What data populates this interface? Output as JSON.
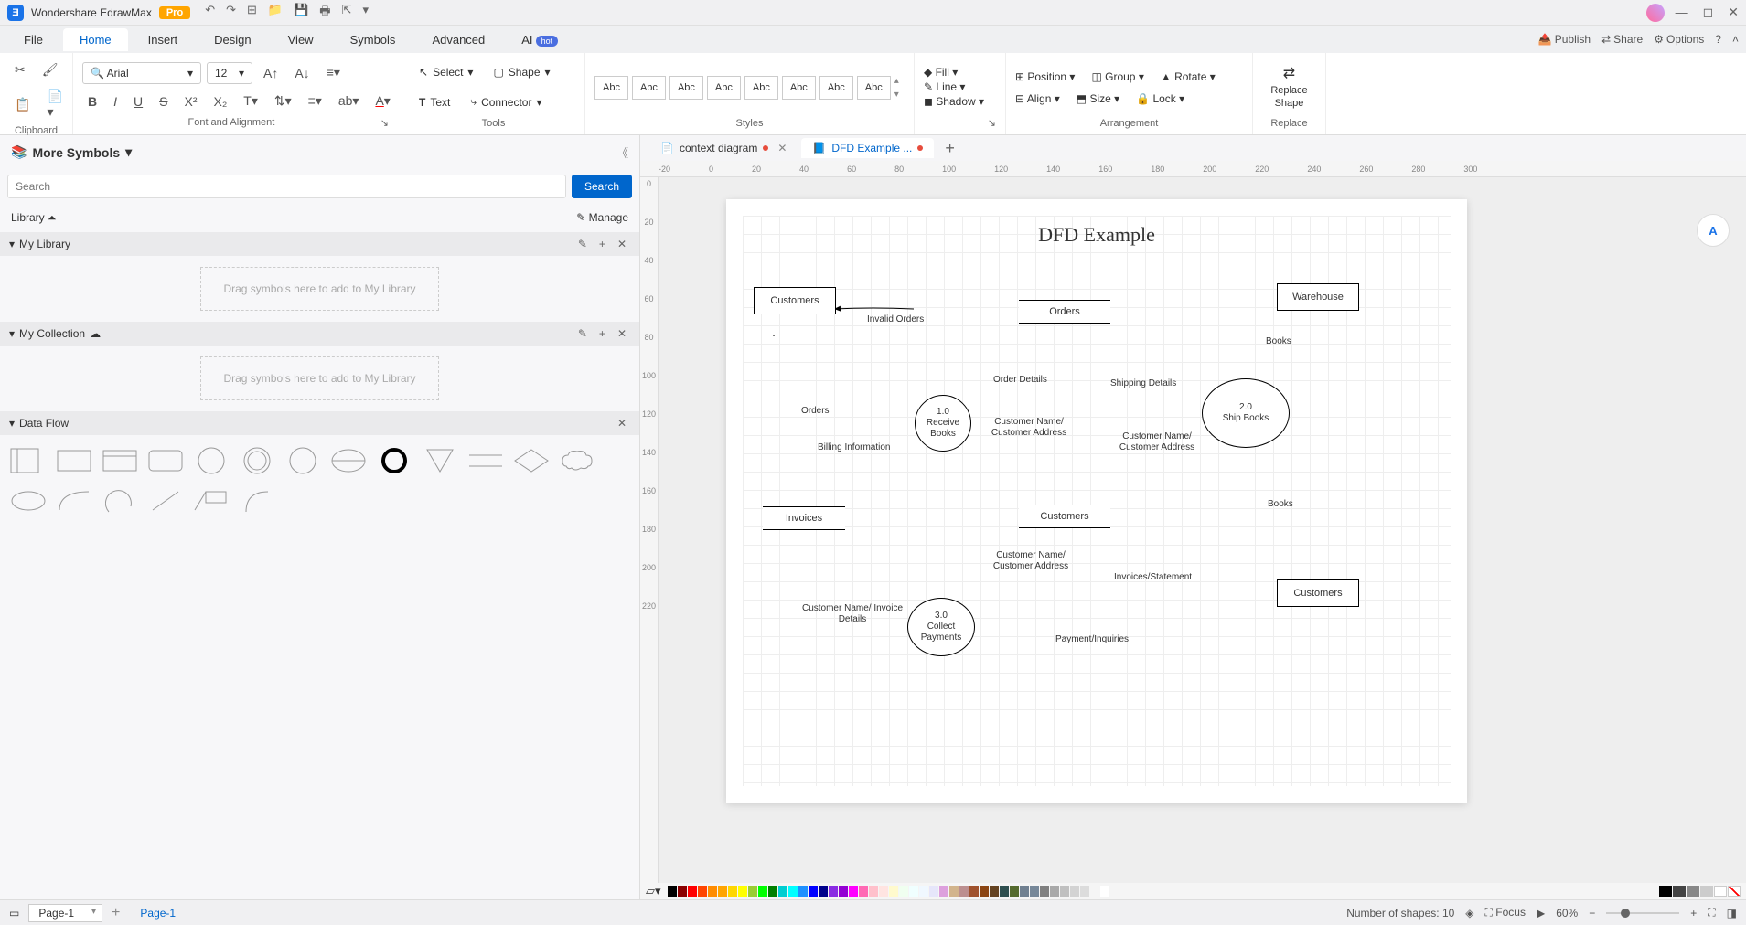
{
  "app": {
    "title": "Wondershare EdrawMax",
    "badge": "Pro"
  },
  "menu": {
    "items": [
      "File",
      "Home",
      "Insert",
      "Design",
      "View",
      "Symbols",
      "Advanced",
      "AI"
    ],
    "active": "Home",
    "hot": "hot",
    "right": {
      "publish": "Publish",
      "share": "Share",
      "options": "Options"
    }
  },
  "ribbon": {
    "font": "Arial",
    "size": "12",
    "select": "Select",
    "shape": "Shape",
    "text": "Text",
    "connector": "Connector",
    "styles_label": "Abc",
    "fill": "Fill",
    "line": "Line",
    "shadow": "Shadow",
    "position": "Position",
    "align": "Align",
    "group": "Group",
    "size_btn": "Size",
    "rotate": "Rotate",
    "lock": "Lock",
    "replace_shape": "Replace Shape",
    "groups": {
      "clipboard": "Clipboard",
      "font": "Font and Alignment",
      "tools": "Tools",
      "styles": "Styles",
      "arrangement": "Arrangement",
      "replace": "Replace"
    }
  },
  "panel": {
    "title": "More Symbols",
    "search_placeholder": "Search",
    "search_btn": "Search",
    "library": "Library",
    "manage": "Manage",
    "my_library": "My Library",
    "my_collection": "My Collection",
    "data_flow": "Data Flow",
    "drop1": "Drag symbols here to add to My Library",
    "drop2": "Drag symbols here to add to My Library"
  },
  "tabs": {
    "t1": "context diagram",
    "t2": "DFD Example ..."
  },
  "ruler_h": [
    "-20",
    "0",
    "20",
    "40",
    "60",
    "80",
    "100",
    "120",
    "140",
    "160",
    "180",
    "200",
    "220",
    "240",
    "260",
    "280",
    "300"
  ],
  "ruler_v": [
    "0",
    "20",
    "40",
    "60",
    "80",
    "100",
    "120",
    "140",
    "160",
    "180",
    "200",
    "220"
  ],
  "diagram": {
    "title": "DFD Example",
    "entities": {
      "customers1": "Customers",
      "warehouse": "Warehouse",
      "customers2": "Customers"
    },
    "datastores": {
      "orders": "Orders",
      "invoices": "Invoices",
      "customers": "Customers"
    },
    "processes": {
      "p1_num": "1.0",
      "p1_name": "Receive Books",
      "p2_num": "2.0",
      "p2_name": "Ship Books",
      "p3_num": "3.0",
      "p3_name": "Collect Payments"
    },
    "flows": {
      "invalid": "Invalid Orders",
      "orders": "Orders",
      "order_details": "Order Details",
      "shipping": "Shipping Details",
      "books1": "Books",
      "books2": "Books",
      "cna1": "Customer Name/ Customer Address",
      "cna2": "Customer Name/ Customer Address",
      "cna3": "Customer Name/ Customer Address",
      "billing": "Billing Information",
      "invst": "Invoices/Statement",
      "payinq": "Payment/Inquiries",
      "cnid": "Customer Name/ Invoice Details"
    }
  },
  "status": {
    "page_sel": "Page-1",
    "page_tab": "Page-1",
    "shapes": "Number of shapes: 10",
    "focus": "Focus",
    "zoom": "60%"
  }
}
